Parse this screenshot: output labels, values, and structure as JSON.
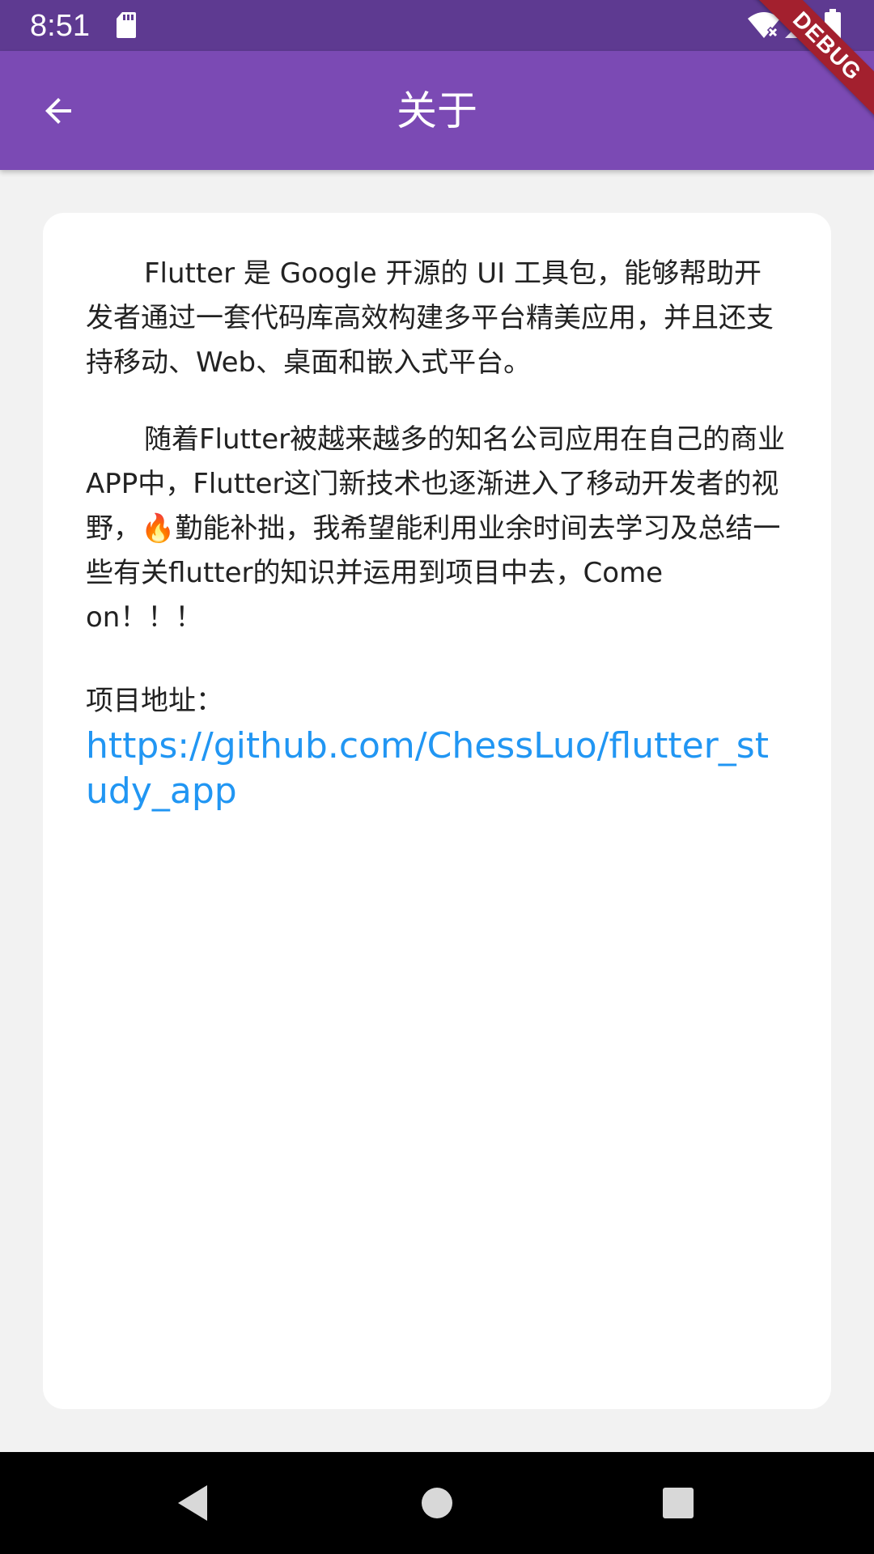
{
  "status_bar": {
    "time": "8:51",
    "icons": [
      "sd-card-icon",
      "wifi-off-icon",
      "signal-icon",
      "battery-icon"
    ]
  },
  "app_bar": {
    "title": "关于",
    "back_icon": "arrow-back-icon"
  },
  "debug_banner": {
    "label": "DEBUG"
  },
  "content": {
    "paragraph_1": "Flutter 是 Google 开源的 UI 工具包，能够帮助开发者通过一套代码库高效构建多平台精美应用，并且还支持移动、Web、桌面和嵌入式平台。",
    "paragraph_2": "随着Flutter被越来越多的知名公司应用在自己的商业APP中，Flutter这门新技术也逐渐进入了移动开发者的视野，🔥勤能补拙，我希望能利用业余时间去学习及总结一些有关flutter的知识并运用到项目中去，Come on！！！",
    "repo_label": "项目地址：",
    "repo_url": "https://github.com/ChessLuo/flutter_study_app"
  },
  "nav_bar": {
    "icons": [
      "nav-back-icon",
      "nav-home-icon",
      "nav-recents-icon"
    ]
  },
  "colors": {
    "status_bar": "#5e3a91",
    "app_bar": "#7b4ab4",
    "background": "#f2f2f2",
    "card": "#ffffff",
    "link": "#2196f3",
    "debug_banner": "#a3202e"
  }
}
